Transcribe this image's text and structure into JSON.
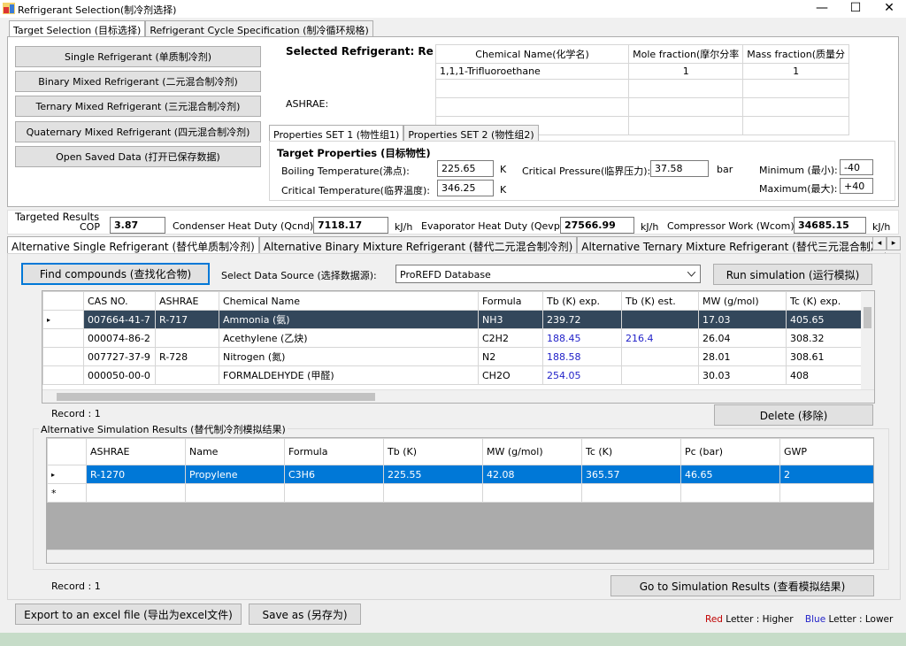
{
  "window": {
    "title": "Refrigerant Selection(制冷剂选择)",
    "minimize": "—",
    "maximize": "☐",
    "close": "✕"
  },
  "main_tabs": [
    {
      "label": "Target Selection (目标选择)"
    },
    {
      "label": "Refrigerant Cycle Specification (制冷循环规格)"
    }
  ],
  "left_buttons": [
    "Single Refrigerant (单质制冷剂)",
    "Binary Mixed Refrigerant (二元混合制冷剂)",
    "Ternary Mixed Refrigerant (三元混合制冷剂)",
    "Quaternary Mixed Refrigerant (四元混合制冷剂)",
    "Open Saved Data (打开已保存数据)"
  ],
  "selected_label": "Selected Refrigerant: Re",
  "ashrae_label": "ASHRAE:",
  "composition": {
    "headers": [
      "Chemical Name(化学名)",
      "Mole fraction(摩尔分率",
      "Mass fraction(质量分"
    ],
    "rows": [
      [
        "1,1,1-Trifluoroethane",
        "1",
        "1"
      ],
      [
        "",
        "",
        ""
      ],
      [
        "",
        "",
        ""
      ],
      [
        "",
        "",
        ""
      ]
    ]
  },
  "prop_tabs": [
    "Properties SET 1 (物性组1)",
    "Properties SET 2 (物性组2)"
  ],
  "target": {
    "heading": "Target Properties (目标物性)",
    "boiling_label": "Boiling Temperature(沸点):",
    "boiling_value": "225.65",
    "boiling_unit": "K",
    "critical_t_label": "Critical Temperature(临界温度):",
    "critical_t_value": "346.25",
    "critical_t_unit": "K",
    "critical_p_label": "Critical Pressure(临界压力):",
    "critical_p_value": "37.58",
    "critical_p_unit": "bar",
    "min_label": "Minimum (最小):",
    "min_value": "-40",
    "max_label": "Maximum(最大):",
    "max_value": "+40"
  },
  "results": {
    "title": "Targeted Results",
    "cop_label": "COP",
    "cop_value": "3.87",
    "qcnd_label": "Condenser Heat Duty (Qcnd)",
    "qcnd_value": "7118.17",
    "qcnd_unit": "kJ/h",
    "qevp_label": "Evaporator Heat Duty (Qevp)",
    "qevp_value": "27566.99",
    "qevp_unit": "kJ/h",
    "wcom_label": "Compressor Work (Wcom)",
    "wcom_value": "34685.15",
    "wcom_unit": "kJ/h"
  },
  "alt_tabs": [
    "Alternative Single Refrigerant (替代单质制冷剂)",
    "Alternative Binary Mixture Refrigerant (替代二元混合制冷剂)",
    "Alternative Ternary Mixture Refrigerant (替代三元混合制冷"
  ],
  "tab_scroll": {
    "left": "◂",
    "right": "▸"
  },
  "find_button": "Find compounds (查找化合物)",
  "source_label": "Select Data Source (选择数据源):",
  "source_value": "ProREFD Database",
  "run_button": "Run simulation (运行模拟)",
  "compounds": {
    "headers": [
      "CAS NO.",
      "ASHRAE",
      "Chemical Name",
      "Formula",
      "Tb (K) exp.",
      "Tb (K) est.",
      "MW (g/mol)",
      "Tc (K) exp."
    ],
    "rows": [
      [
        "007664-41-7",
        "R-717",
        "Ammonia (氨)",
        "NH3",
        "239.72",
        "",
        "17.03",
        "405.65"
      ],
      [
        "000074-86-2",
        "",
        "Acethylene (乙炔)",
        "C2H2",
        "188.45",
        "216.4",
        "26.04",
        "308.32"
      ],
      [
        "007727-37-9",
        "R-728",
        "Nitrogen (氮)",
        "N2",
        "188.58",
        "",
        "28.01",
        "308.61"
      ],
      [
        "000050-00-0",
        "",
        "FORMALDEHYDE (甲醛)",
        "CH2O",
        "254.05",
        "",
        "30.03",
        "408"
      ]
    ]
  },
  "record1": "Record : 1",
  "delete_button": "Delete (移除)",
  "sim_group_title": "Alternative Simulation Results (替代制冷剂模拟结果)",
  "sim": {
    "headers": [
      "ASHRAE",
      "Name",
      "Formula",
      "Tb (K)",
      "MW (g/mol)",
      "Tc (K)",
      "Pc (bar)",
      "GWP"
    ],
    "rows": [
      [
        "R-1270",
        "Propylene",
        "C3H6",
        "225.55",
        "42.08",
        "365.57",
        "46.65",
        "2"
      ]
    ],
    "new_row_marker": "*",
    "row_marker": "▸"
  },
  "record2": "Record : 1",
  "goto_button": "Go to Simulation Results (查看模拟结果)",
  "export_button": "Export to an excel file (导出为excel文件)",
  "saveas_button": "Save as (另存为)",
  "legend": {
    "red_word": "Red",
    "red_text": "Letter : Higher",
    "blue_word": "Blue",
    "blue_text": "Letter : Lower"
  },
  "colors": {
    "selected_row": "#33475b",
    "selected_row_blue": "#0078d7",
    "lower_value": "#1f1fc8",
    "higher_value": "#c00000"
  }
}
